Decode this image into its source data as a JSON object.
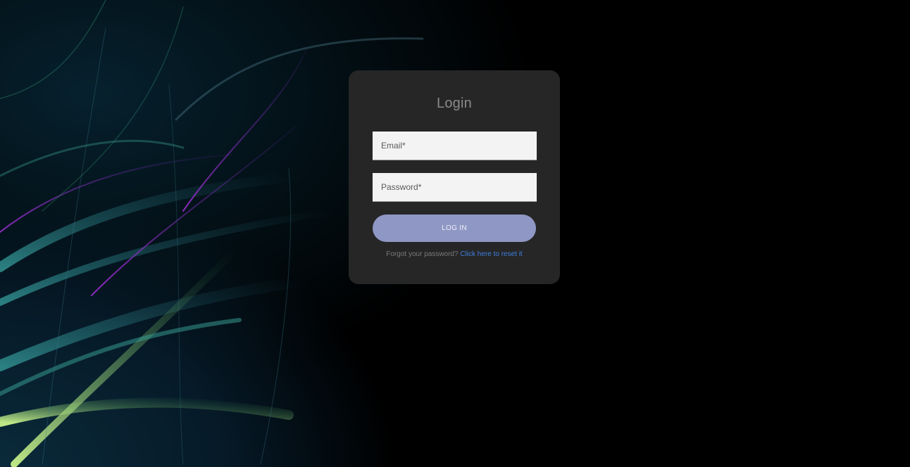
{
  "login": {
    "title": "Login",
    "email_placeholder": "Email*",
    "email_value": "",
    "password_placeholder": "Password*",
    "password_value": "",
    "submit_label": "LOG IN",
    "forgot_text": "Forgot your password?",
    "reset_link": "Click here to reset it"
  },
  "colors": {
    "card": "#262626",
    "button": "#8f97c4",
    "link": "#3f7fe0",
    "background": "#000000"
  }
}
